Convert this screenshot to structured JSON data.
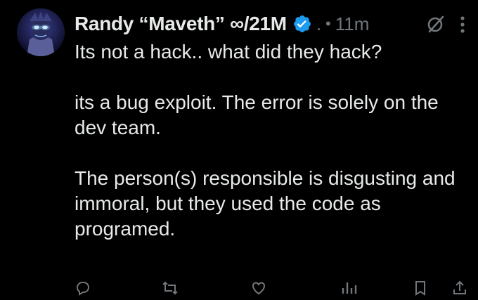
{
  "tweet": {
    "display_name": "Randy “Maveth” ∞/21M",
    "verified_icon": "verified-badge-icon",
    "handle": ".",
    "separator": "•",
    "time": "11m",
    "paragraphs": [
      "Its not a hack.. what did they hack?",
      "its a bug exploit. The error is solely on the dev team.",
      "The person(s) responsible is disgusting and immoral, but they used the code as programed."
    ]
  },
  "icons": {
    "grok": "grok-slash-icon",
    "more": "more-icon",
    "actions": [
      "reply-icon",
      "retweet-icon",
      "like-icon",
      "views-icon",
      "bookmark-icon",
      "share-icon"
    ]
  },
  "colors": {
    "background": "#000000",
    "text": "#e7e9ea",
    "secondary": "#71767b",
    "verified": "#1d9bf0"
  }
}
